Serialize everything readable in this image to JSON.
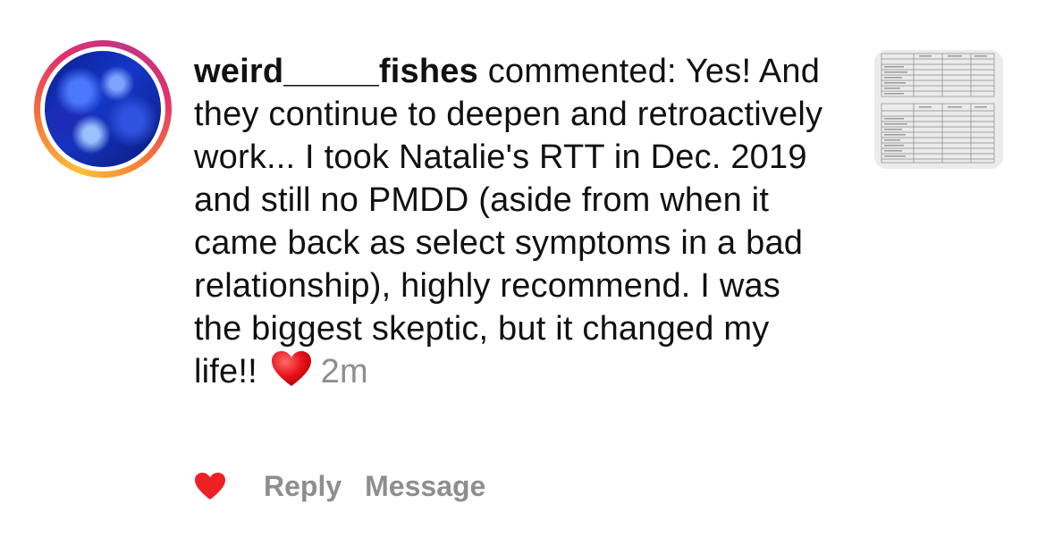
{
  "comment": {
    "username": "weird_____fishes",
    "action_text": " commented: Yes! And they continue to deepen and retroactively work... I took Natalie's RTT in Dec. 2019 and still no PMDD (aside from when it came back as select symptoms in a bad relationship), highly recommend. I was the biggest skeptic, but it changed my life!!",
    "emoji": "red-heart",
    "timestamp": "2m"
  },
  "actions": {
    "like_icon": "heart-filled-icon",
    "reply_label": "Reply",
    "message_label": "Message"
  },
  "colors": {
    "accent_like": "#ed2024",
    "muted_text": "#8e8e8e",
    "ring_gradient": [
      "#fdc035",
      "#f77737",
      "#e1306c",
      "#c13584"
    ]
  }
}
